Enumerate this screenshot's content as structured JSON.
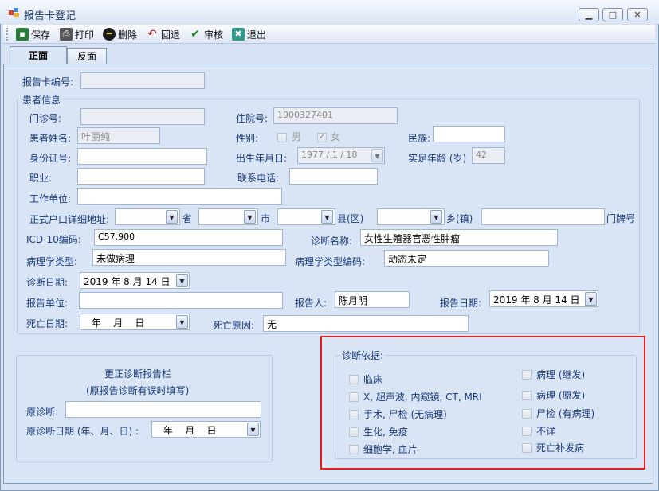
{
  "window": {
    "title": "报告卡登记"
  },
  "toolbar": {
    "save": "保存",
    "print": "打印",
    "delete": "删除",
    "rollback": "回退",
    "audit": "审核",
    "exit": "退出"
  },
  "tabs": {
    "front": "正面",
    "back": "反面"
  },
  "form": {
    "card_no_label": "报告卡编号:",
    "patient_group": "患者信息",
    "outpatient_label": "门诊号:",
    "inpatient_label": "住院号:",
    "inpatient_value": "1900327401",
    "name_label": "患者姓名:",
    "name_value": "叶丽纯",
    "gender_label": "性别:",
    "male": "男",
    "female": "女",
    "nation_label": "民族:",
    "id_label": "身份证号:",
    "birth_label": "出生年月日:",
    "birth_value": "1977 / 1 / 18",
    "age_label": "实足年龄 (岁)",
    "age_value": "42",
    "job_label": "职业:",
    "phone_label": "联系电话:",
    "workplace_label": "工作单位:",
    "address_label": "正式户口详细地址:",
    "province": "省",
    "city": "市",
    "county": "县(区)",
    "town": "乡(镇)",
    "house_no": "门牌号",
    "icd_label": "ICD-10编码:",
    "icd_value": "C57.900",
    "diag_name_label": "诊断名称:",
    "diag_name_value": "女性生殖器官恶性肿瘤",
    "path_type_label": "病理学类型:",
    "path_type_value": "未做病理",
    "path_code_label": "病理学类型编码:",
    "path_code_value": "动态未定",
    "diag_date_label": "诊断日期:",
    "diag_date_value": "2019 年 8 月 14 日",
    "report_unit_label": "报告单位:",
    "reporter_label": "报告人:",
    "reporter_value": "陈月明",
    "report_date_label": "报告日期:",
    "report_date_value": "2019 年 8 月 14 日",
    "death_date_label": "死亡日期:",
    "death_date_value": "年    月    日",
    "death_cause_label": "死亡原因:",
    "death_cause_value": "无"
  },
  "correction": {
    "title1": "更正诊断报告栏",
    "title2": "(原报告诊断有误时填写)",
    "orig_diag_label": "原诊断:",
    "orig_date_label": "原诊断日期 (年、月、日) :",
    "orig_date_value": "年    月    日"
  },
  "basis": {
    "title": "诊断依据:",
    "left": [
      "临床",
      "X, 超声波, 内窥镜, CT, MRI",
      "手术, 尸检 (无病理)",
      "生化, 免疫",
      "细胞学, 血片"
    ],
    "right": [
      "病理 (继发)",
      "病理 (原发)",
      "尸检 (有病理)",
      "不详",
      "死亡补发病"
    ]
  },
  "colors": {
    "highlight": "#e81c1c",
    "panel": "#d9e5f5"
  }
}
